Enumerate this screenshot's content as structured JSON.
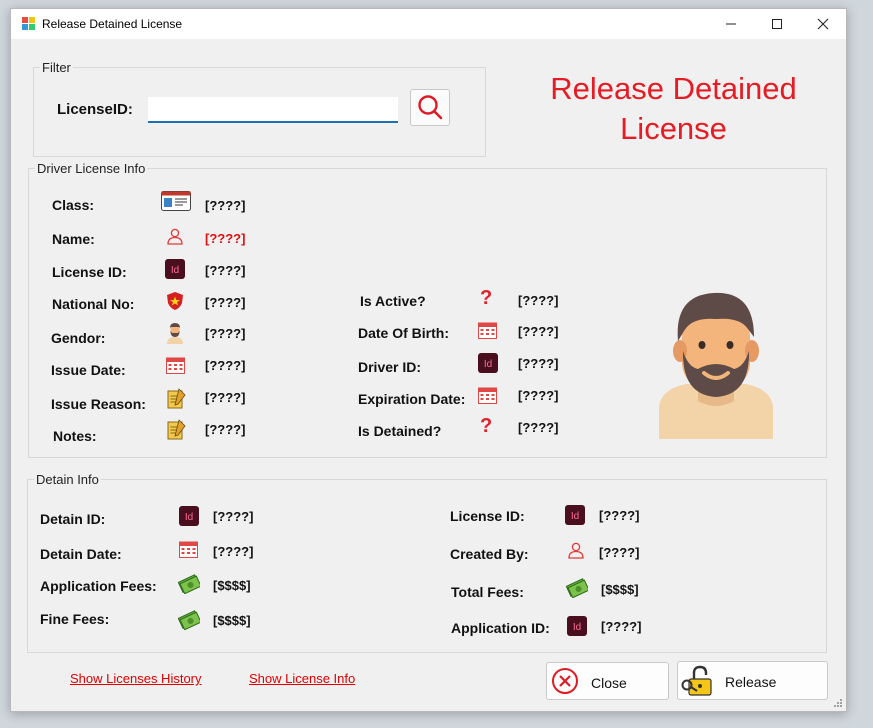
{
  "window": {
    "title": "Release Detained License"
  },
  "header": {
    "title_line1": "Release Detained",
    "title_line2": "License"
  },
  "filter": {
    "group_title": "Filter",
    "license_id_label": "LicenseID:",
    "license_id_value": "",
    "search_icon": "search-icon"
  },
  "driver_info": {
    "group_title": "Driver License Info",
    "class_label": "Class:",
    "class_value": "[????]",
    "name_label": "Name:",
    "name_value": "[????]",
    "license_id_label": "License ID:",
    "license_id_value": "[????]",
    "national_no_label": "National No:",
    "national_no_value": "[????]",
    "gendor_label": "Gendor:",
    "gendor_value": "[????]",
    "issue_date_label": "Issue Date:",
    "issue_date_value": "[????]",
    "issue_reason_label": "Issue Reason:",
    "issue_reason_value": "[????]",
    "notes_label": "Notes:",
    "notes_value": "[????]",
    "is_active_label": "Is Active?",
    "is_active_value": "[????]",
    "dob_label": "Date Of Birth:",
    "dob_value": "[????]",
    "driver_id_label": "Driver ID:",
    "driver_id_value": "[????]",
    "expiration_label": "Expiration Date:",
    "expiration_value": "[????]",
    "is_detained_label": "Is Detained?",
    "is_detained_value": "[????]"
  },
  "detain_info": {
    "group_title": "Detain Info",
    "detain_id_label": "Detain ID:",
    "detain_id_value": "[????]",
    "detain_date_label": "Detain Date:",
    "detain_date_value": "[????]",
    "app_fees_label": "Application Fees:",
    "app_fees_value": "[$$$$]",
    "fine_fees_label": "Fine Fees:",
    "fine_fees_value": "[$$$$]",
    "license_id_label": "License ID:",
    "license_id_value": "[????]",
    "created_by_label": "Created By:",
    "created_by_value": "[????]",
    "total_fees_label": "Total Fees:",
    "total_fees_value": "[$$$$]",
    "application_id_label": "Application ID:",
    "application_id_value": "[????]"
  },
  "footer": {
    "show_history": "Show Licenses History",
    "show_info": "Show License Info",
    "close_label": "Close",
    "release_label": "Release"
  },
  "colors": {
    "accent_red": "#e51c23",
    "input_underline": "#1f6fb5",
    "id_badge": "#4a0f1f"
  }
}
